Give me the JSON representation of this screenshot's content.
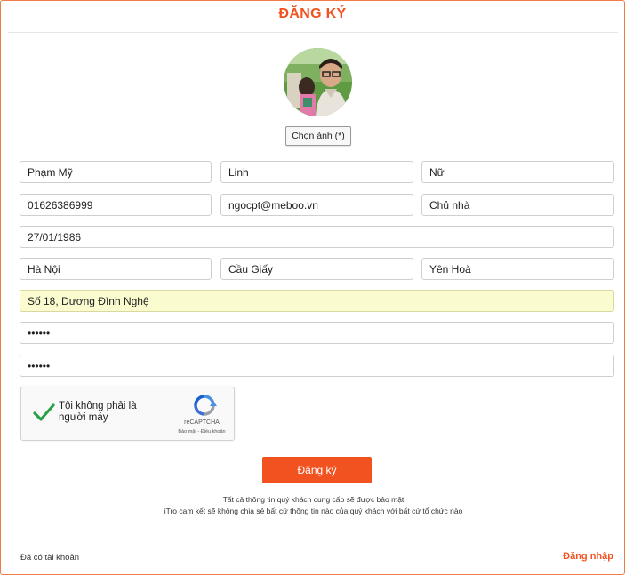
{
  "header": {
    "title": "ĐĂNG KÝ"
  },
  "avatar": {
    "choose_label": "Chọn ảnh (*)"
  },
  "form": {
    "last_name": "Phạm Mỹ",
    "first_name": "Linh",
    "gender": "Nữ",
    "phone": "01626386999",
    "email": "ngocpt@meboo.vn",
    "role": "Chủ nhà",
    "birthdate": "27/01/1986",
    "city": "Hà Nội",
    "district": "Cầu Giấy",
    "ward": "Yên Hoà",
    "address": "Số 18, Dương Đình Nghệ",
    "password": "••••••",
    "password_confirm": "••••••"
  },
  "captcha": {
    "label": "Tôi không phải là người máy",
    "brand": "reCAPTCHA",
    "terms": "Bảo mật - Điều khoản"
  },
  "submit": {
    "label": "Đăng ký"
  },
  "notice": {
    "line1": "Tất cả thông tin quý khách cung cấp sẽ được bảo mật",
    "line2": "iTro cam kết sẽ không chia sẻ bất cứ thông tin nào của quý khách với bất cứ tổ chức nào"
  },
  "footer": {
    "have_account": "Đã có tài khoản",
    "login_link": "Đăng nhập"
  },
  "colors": {
    "accent": "#f1521f",
    "highlight": "#fbfbd0"
  }
}
